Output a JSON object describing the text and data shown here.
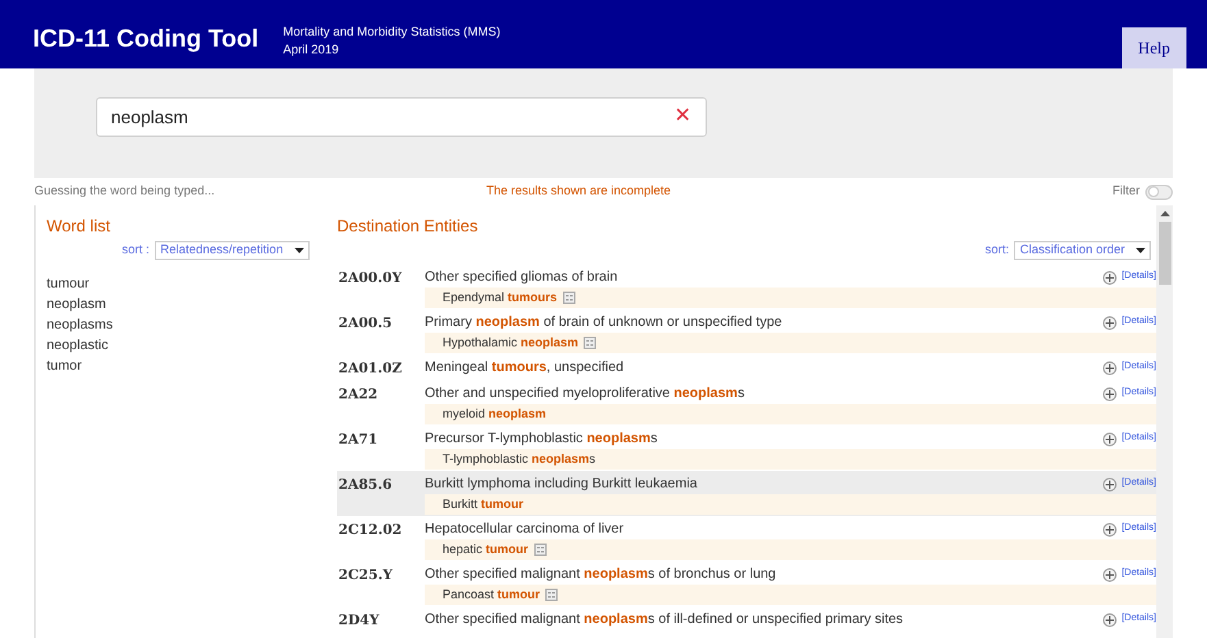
{
  "header": {
    "title": "ICD-11 Coding Tool",
    "subtitle": "Mortality and Morbidity Statistics (MMS)",
    "release": "April 2019",
    "help_button": "Help"
  },
  "search": {
    "value": "neoplasm",
    "clear_icon": "✕"
  },
  "status": {
    "guess": "Guessing the word being typed...",
    "warning": "The results shown are incomplete",
    "filter_label": "Filter",
    "filter_on": false
  },
  "word_list": {
    "title": "Word list",
    "sort_label": "sort :",
    "sort_value": "Relatedness/repetition",
    "words": [
      "tumour",
      "neoplasm",
      "neoplasms",
      "neoplastic",
      "tumor"
    ]
  },
  "destination": {
    "title": "Destination Entities",
    "sort_label": "sort:",
    "sort_value": "Classification order",
    "rows": [
      {
        "code": "2A00.0Y",
        "title": "Other specified gliomas of brain",
        "synonym": "Ependymal **tumours**",
        "note_icon": true,
        "selected": false,
        "details_label": "[Details]"
      },
      {
        "code": "2A00.5",
        "title": "Primary **neoplasm** of brain of unknown or unspecified type",
        "synonym": "Hypothalamic **neoplasm**",
        "note_icon": true,
        "selected": false,
        "details_label": "[Details]"
      },
      {
        "code": "2A01.0Z",
        "title": "Meningeal **tumours**, unspecified",
        "selected": false,
        "details_label": "[Details]"
      },
      {
        "code": "2A22",
        "title": "Other and unspecified myeloproliferative **neoplasm**s",
        "synonym": "myeloid **neoplasm**",
        "note_icon": false,
        "selected": false,
        "details_label": "[Details]"
      },
      {
        "code": "2A71",
        "title": "Precursor T-lymphoblastic **neoplasm**s",
        "synonym": "T-lymphoblastic **neoplasm**s",
        "note_icon": false,
        "selected": false,
        "details_label": "[Details]"
      },
      {
        "code": "2A85.6",
        "title": "Burkitt lymphoma including Burkitt leukaemia",
        "synonym": "Burkitt **tumour**",
        "note_icon": false,
        "selected": true,
        "details_label": "[Details]"
      },
      {
        "code": "2C12.02",
        "title": "Hepatocellular carcinoma of liver",
        "synonym": "hepatic **tumour**",
        "note_icon": true,
        "selected": false,
        "details_label": "[Details]"
      },
      {
        "code": "2C25.Y",
        "title": "Other specified malignant **neoplasm**s of bronchus or lung",
        "synonym": "Pancoast **tumour**",
        "note_icon": true,
        "selected": false,
        "details_label": "[Details]"
      },
      {
        "code": "2D4Y",
        "title": "Other specified malignant **neoplasm**s of ill-defined or unspecified primary sites",
        "selected": false,
        "details_label": "[Details]"
      }
    ]
  }
}
